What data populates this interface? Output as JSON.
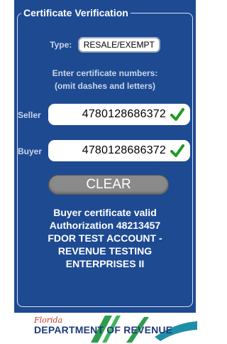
{
  "panel": {
    "title": "Certificate Verification",
    "type_label": "Type:",
    "type_value": "RESALE/EXEMPT",
    "instructions_line1": "Enter certificate numbers:",
    "instructions_line2": "(omit dashes and letters)",
    "seller_label": "Seller",
    "seller_value": "4780128686372",
    "buyer_label": "Buyer",
    "buyer_value": "4780128686372",
    "clear_label": "CLEAR",
    "result_lines": [
      "Buyer certificate valid",
      "Authorization 48213457",
      "FDOR TEST ACCOUNT -",
      "REVENUE TESTING",
      "ENTERPRISES II"
    ]
  },
  "footer": {
    "florida": "Florida",
    "department": "DEPARTMENT OF REVENUE"
  },
  "colors": {
    "panel": "#1e4a92",
    "check": "#1f9a25",
    "button": "#8a8a8a"
  },
  "icons": {
    "valid": "checkmark-icon"
  }
}
